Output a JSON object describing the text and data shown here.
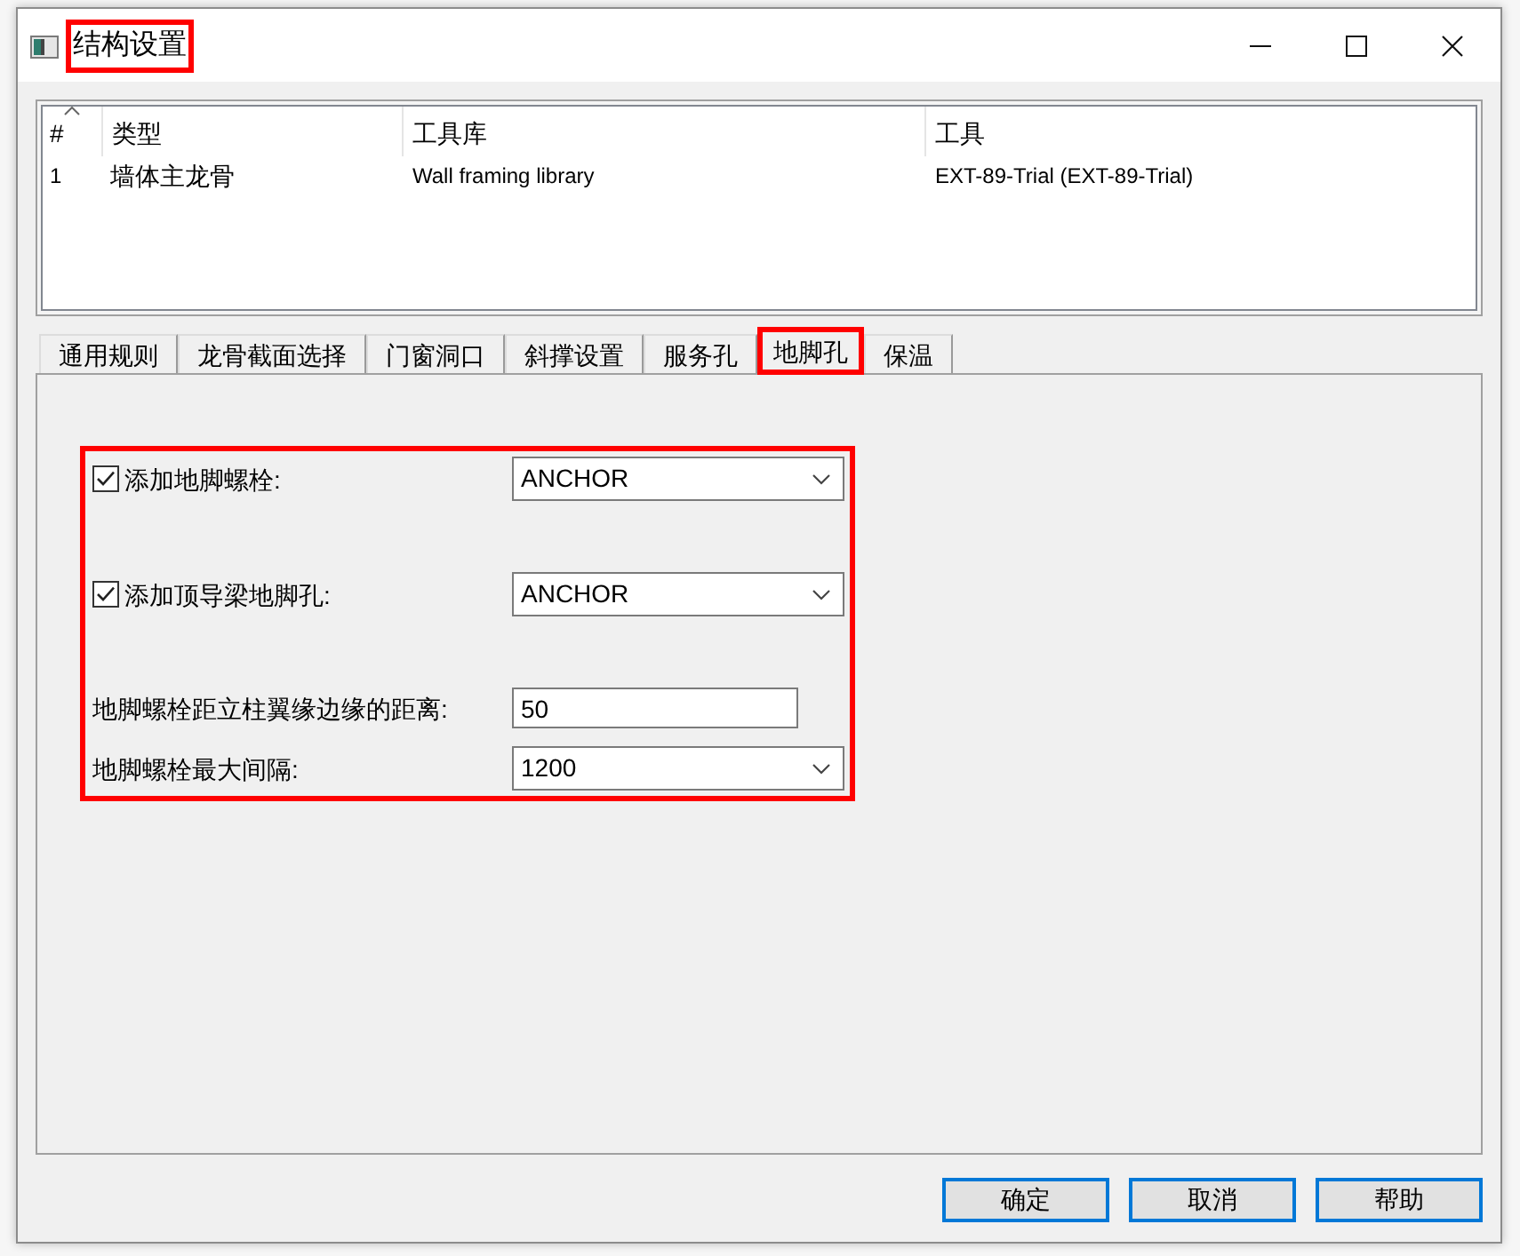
{
  "window": {
    "title": "结构设置",
    "highlighted": true
  },
  "tool_list": {
    "columns": [
      {
        "label": "#",
        "sorted": true
      },
      {
        "label": "类型",
        "sorted": false
      },
      {
        "label": "工具库",
        "sorted": false
      },
      {
        "label": "工具",
        "sorted": false
      }
    ],
    "rows": [
      {
        "cells": [
          "1",
          "墙体主龙骨",
          "Wall framing library",
          "EXT-89-Trial (EXT-89-Trial)"
        ]
      }
    ]
  },
  "tabs": [
    {
      "label": "通用规则",
      "selected": false,
      "highlighted": false
    },
    {
      "label": "龙骨截面选择",
      "selected": false,
      "highlighted": false
    },
    {
      "label": "门窗洞口",
      "selected": false,
      "highlighted": false
    },
    {
      "label": "斜撑设置",
      "selected": false,
      "highlighted": false
    },
    {
      "label": "服务孔",
      "selected": false,
      "highlighted": false
    },
    {
      "label": "地脚孔",
      "selected": true,
      "highlighted": true
    },
    {
      "label": "保温",
      "selected": false,
      "highlighted": false
    }
  ],
  "settings": {
    "highlighted": true,
    "fields": [
      {
        "kind": "checkbox",
        "label": "添加地脚螺栓:",
        "checked": true,
        "value": "ANCHOR"
      },
      {
        "kind": "checkbox",
        "label": "添加顶导梁地脚孔:",
        "checked": true,
        "value": "ANCHOR"
      },
      {
        "kind": "text",
        "label": "地脚螺栓距立柱翼缘边缘的距离:",
        "value": "50"
      },
      {
        "kind": "dropdown",
        "label": "地脚螺栓最大间隔:",
        "value": "1200"
      }
    ]
  },
  "buttons": [
    {
      "label": "确定"
    },
    {
      "label": "取消"
    },
    {
      "label": "帮助"
    }
  ]
}
